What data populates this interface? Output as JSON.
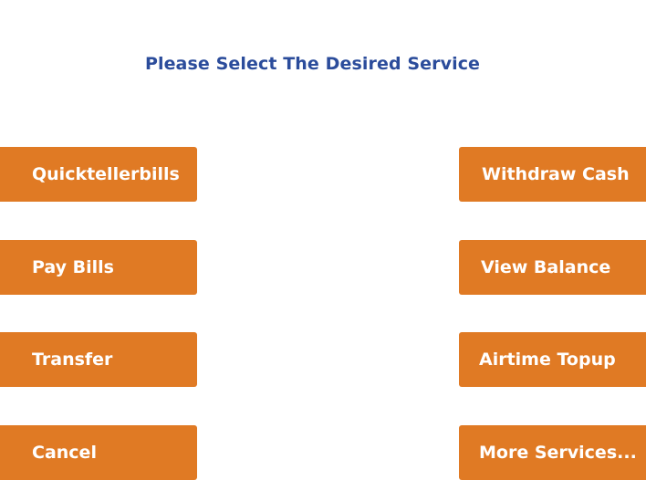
{
  "header": {
    "title": "Please Select The Desired Service"
  },
  "left_buttons": [
    {
      "label": "Quicktellerbills"
    },
    {
      "label": "Pay Bills"
    },
    {
      "label": "Transfer"
    },
    {
      "label": "Cancel"
    }
  ],
  "right_buttons": [
    {
      "label": "Withdraw Cash"
    },
    {
      "label": "View Balance"
    },
    {
      "label": "Airtime Topup"
    },
    {
      "label": "More Services..."
    }
  ],
  "colors": {
    "title": "#2b4c9b",
    "button_bg": "#e07a24",
    "button_text": "#ffffff",
    "background": "#ffffff"
  }
}
